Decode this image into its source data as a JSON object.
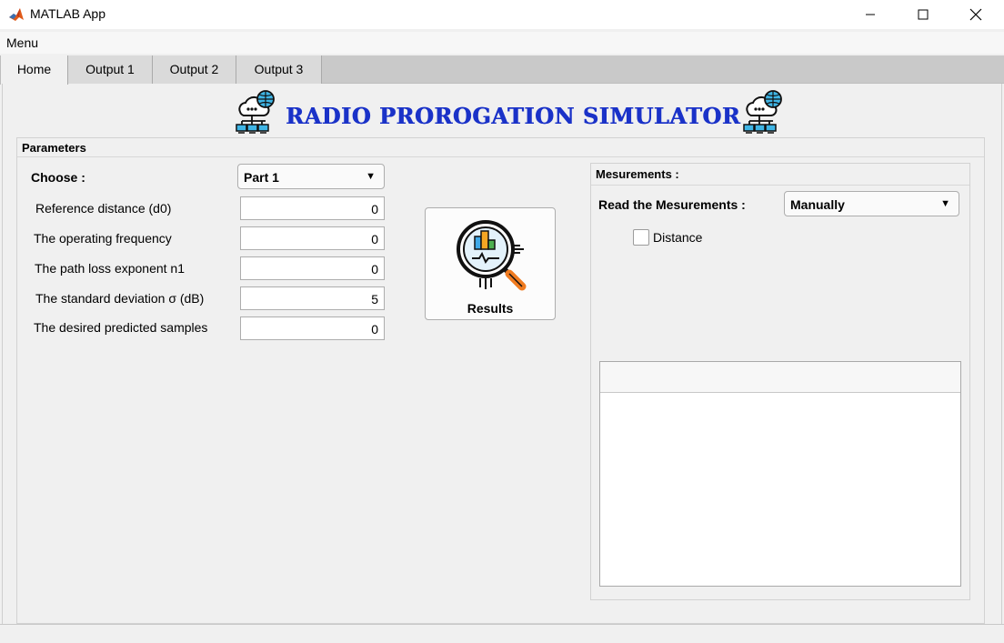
{
  "window": {
    "title": "MATLAB App"
  },
  "menu": {
    "label": "Menu"
  },
  "tabs": [
    {
      "label": "Home",
      "active": true
    },
    {
      "label": "Output 1",
      "active": false
    },
    {
      "label": "Output 2",
      "active": false
    },
    {
      "label": "Output 3",
      "active": false
    }
  ],
  "banner": {
    "title": "RADIO PROROGATION SIMULATOR",
    "title_color": "#1a32c8",
    "icon": "cloud-network-icon"
  },
  "parameters": {
    "title": "Parameters",
    "choose_label": "Choose :",
    "choose_value": "Part 1",
    "fields": [
      {
        "label": "Reference distance (d0)",
        "value": "0"
      },
      {
        "label": "The operating frequency",
        "value": "0"
      },
      {
        "label": "The path loss exponent n1",
        "value": "0"
      },
      {
        "label": "The standard deviation σ (dB)",
        "value": "5"
      },
      {
        "label": "The desired predicted samples",
        "value": "0"
      }
    ],
    "results_label": "Results",
    "results_icon": "magnifier-chart-icon"
  },
  "measurements": {
    "title": "Mesurements :",
    "read_label": "Read the Mesurements :",
    "read_value": "Manually",
    "distance_label": "Distance",
    "distance_checked": false
  }
}
